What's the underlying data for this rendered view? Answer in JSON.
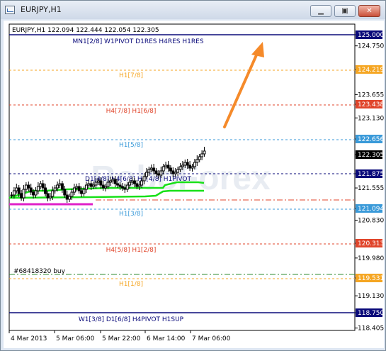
{
  "window": {
    "title": "EURJPY,H1",
    "buttons": [
      "minimize",
      "maximize",
      "close"
    ]
  },
  "chart": {
    "header": "EURJPY,H1  122.094 122.444 122.054 122.305",
    "watermark": "RoboForex",
    "price_scale": [
      "125.000",
      "124.750",
      "124.219",
      "123.655",
      "123.438",
      "123.130",
      "122.656",
      "122.305",
      "121.875",
      "121.555",
      "121.094",
      "120.830",
      "120.313",
      "119.980",
      "119.531",
      "119.130",
      "118.750",
      "118.405"
    ],
    "time_labels": [
      "4 Mar 2013",
      "5 Mar 06:00",
      "5 Mar 22:00",
      "6 Mar 14:00",
      "7 Mar 06:00"
    ],
    "levels": [
      {
        "label": "MN1[2/8] W1PIVOT D1RES H4RES H1RES",
        "price": "125.000",
        "color": "#0a0a7a"
      },
      {
        "label": "H1[7/8]",
        "price": "124.219",
        "color": "#f5a623"
      },
      {
        "label": "H4[7/8] H1[6/8]",
        "price": "123.438",
        "color": "#e0452b"
      },
      {
        "label": "H1[5/8]",
        "price": "122.656",
        "color": "#3a9ad9"
      },
      {
        "label": "D1[4/8] H4[6/8] H1[4/8] H1PIVOT",
        "price": "121.875",
        "color": "#0a0a7a"
      },
      {
        "label": "H1[3/8]",
        "price": "121.094",
        "color": "#3a9ad9"
      },
      {
        "label": "H4[5/8] H1[2/8]",
        "price": "120.313",
        "color": "#e0452b"
      },
      {
        "label": "H1[1/8]",
        "price": "119.531",
        "color": "#f5a623"
      },
      {
        "label": "W1[3/8] D1[6/8] H4PIVOT H1SUP",
        "price": "118.750",
        "color": "#0a0a7a"
      }
    ],
    "order_label": "#68418320 buy",
    "current_price": "122.305"
  }
}
